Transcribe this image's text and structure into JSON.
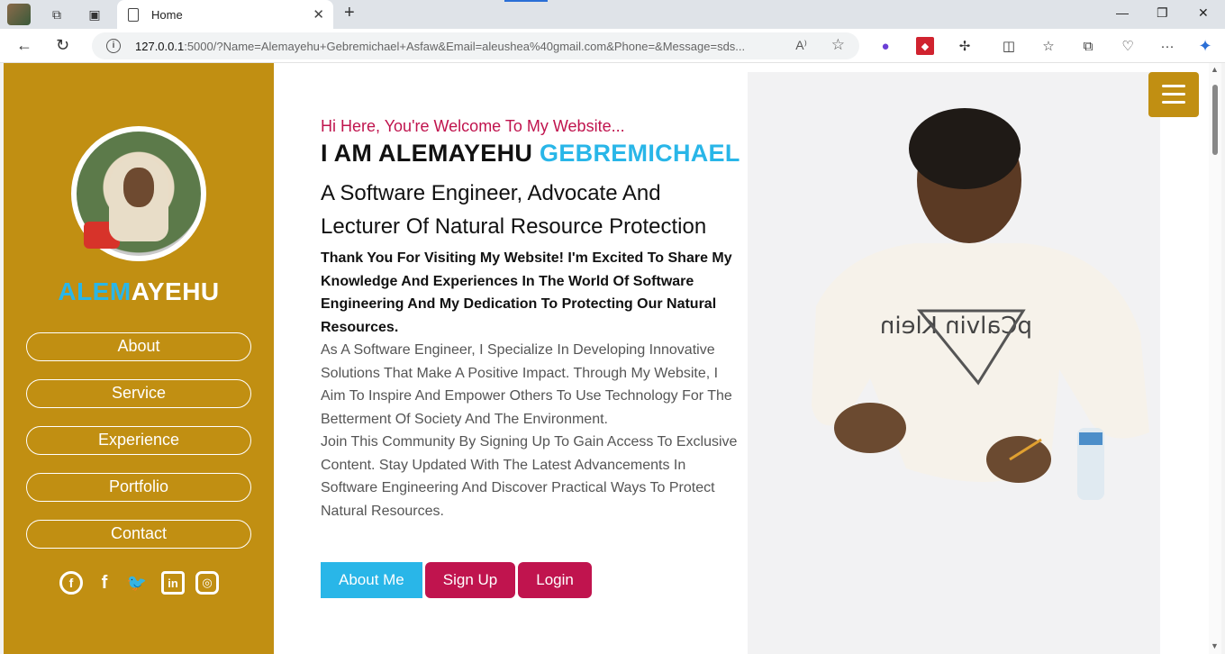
{
  "browser": {
    "tab_title": "Home",
    "close_tab": "✕",
    "new_tab": "+",
    "url_host": "127.0.0.1",
    "url_rest": ":5000/?Name=Alemayehu+Gebremichael+Asfaw&Email=aleushea%40gmail.com&Phone=&Message=sds...",
    "minimize": "—",
    "restore": "❐",
    "close": "✕",
    "back": "←",
    "reload": "↻",
    "read_aloud": "A⁾",
    "favorite": "☆",
    "more": "···"
  },
  "sidebar": {
    "name_highlight": "ALEM",
    "name_rest": "AYEHU",
    "nav": [
      "About",
      "Service",
      "Experience",
      "Portfolio",
      "Contact"
    ],
    "social": {
      "facebook_round": "f",
      "facebook": "f",
      "twitter": "🐦",
      "linkedin": "in",
      "instagram": "◎"
    }
  },
  "hero": {
    "greeting": "Hi Here, You're Welcome To My Website...",
    "headline_part1": "I AM ALEMAYEHU ",
    "headline_part2": "GEBREMICHAEL",
    "subheadline": "A Software Engineer, Advocate And Lecturer Of Natural Resource Protection",
    "intro_bold": "Thank You For Visiting My Website! I'm Excited To Share My Knowledge And Experiences In The World Of Software Engineering And My Dedication To Protecting Our Natural Resources.",
    "para1": "As A Software Engineer, I Specialize In Developing Innovative Solutions That Make A Positive Impact. Through My Website, I Aim To Inspire And Empower Others To Use Technology For The Betterment Of Society And The Environment.",
    "para2": "Join This Community By Signing Up To Gain Access To Exclusive Content. Stay Updated With The Latest Advancements In Software Engineering And Discover Practical Ways To Protect Natural Resources.",
    "buttons": {
      "about": "About Me",
      "signup": "Sign Up",
      "login": "Login"
    },
    "shirt_text": "pCalvin Klein"
  },
  "colors": {
    "sidebar": "#c18f12",
    "accent_blue": "#29b6e8",
    "accent_red": "#c0144e"
  }
}
